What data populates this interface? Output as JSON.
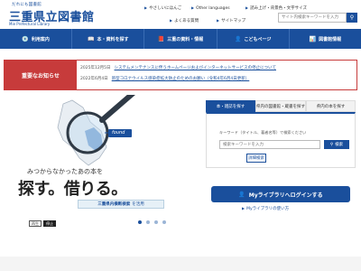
{
  "header": {
    "tagline": "だれにも図書館",
    "library_name": "三重県立図書館",
    "library_name_en": "Mie Prefectural Library",
    "utility_links": [
      "やさしいにほんご",
      "Other languages",
      "読み上げ・背景色・文字サイズ"
    ],
    "quick_links": [
      "よくある質問",
      "サイトマップ"
    ],
    "search_placeholder": "サイト内検索キーワードを入力"
  },
  "nav": {
    "items": [
      {
        "icon": "💿",
        "label": "利用案内"
      },
      {
        "icon": "📖",
        "label": "本・資料を探す"
      },
      {
        "icon": "📕",
        "label": "三重の資料・情報"
      },
      {
        "icon": "👤",
        "label": "こどもページ"
      },
      {
        "icon": "📊",
        "label": "図書館情報"
      }
    ]
  },
  "notice": {
    "label": "重要なお知らせ",
    "items": [
      {
        "date": "2025年12月5日",
        "text": "システムメンテナンスに伴うホームページおよびインターネットサービスの停止について"
      },
      {
        "date": "2022年6月4日",
        "text": "新型コロナウイルス感染症拡大防止のためのお願い（令和4年6月4日更新）"
      }
    ]
  },
  "hero": {
    "found_tag": "found",
    "subtitle": "みつからなかったあの本を",
    "headline": "探す。借りる。",
    "button_label": "三重県内横断検索",
    "button_suffix": "を活用",
    "controls": [
      "再生",
      "停止"
    ]
  },
  "search": {
    "tabs": [
      "本・雑誌を探す",
      "県内の図書館・蔵書を探す",
      "県内の本を探す"
    ],
    "description": "キーワード（タイトル、著者名等）で検索ください",
    "placeholder": "検索キーワードを入力",
    "search_button": "検索",
    "advanced_button": "詳細検索"
  },
  "mylibrary": {
    "login_label": "Myライブラリへログインする",
    "help_link": "Myライブラリの使い方"
  },
  "colors": {
    "brand": "#1a4f9c",
    "notice": "#c73b3b",
    "hero_sky": "#6ea8d8"
  }
}
